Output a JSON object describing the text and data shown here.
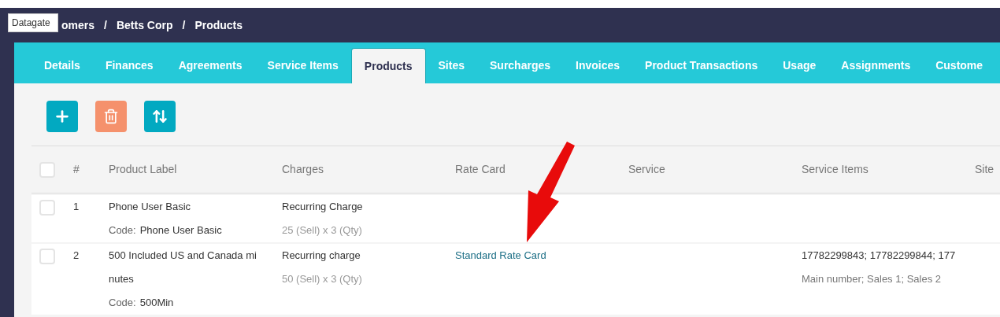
{
  "tooltip": {
    "text": "Datagate"
  },
  "breadcrumb": {
    "items": [
      "omers",
      "Betts Corp",
      "Products"
    ],
    "separator": "/"
  },
  "tabs": [
    {
      "label": "Details",
      "selected": false
    },
    {
      "label": "Finances",
      "selected": false
    },
    {
      "label": "Agreements",
      "selected": false
    },
    {
      "label": "Service Items",
      "selected": false
    },
    {
      "label": "Products",
      "selected": true
    },
    {
      "label": "Sites",
      "selected": false
    },
    {
      "label": "Surcharges",
      "selected": false
    },
    {
      "label": "Invoices",
      "selected": false
    },
    {
      "label": "Product Transactions",
      "selected": false
    },
    {
      "label": "Usage",
      "selected": false
    },
    {
      "label": "Assignments",
      "selected": false
    },
    {
      "label": "Custome",
      "selected": false
    }
  ],
  "toolbar": [
    {
      "kind": "add"
    },
    {
      "kind": "delete"
    },
    {
      "kind": "sort"
    }
  ],
  "table": {
    "select_all_checked": false,
    "columns": [
      "#",
      "Product Label",
      "Charges",
      "Rate Card",
      "Service",
      "Service Items",
      "Site"
    ],
    "rows": [
      {
        "checked": false,
        "number": "1",
        "label": "Phone User Basic",
        "code_label": "Code:",
        "code": "Phone User Basic",
        "charge": "Recurring Charge",
        "charge_detail": "25 (Sell) x 3 (Qty)"
      },
      {
        "checked": false,
        "number": "2",
        "label": "500 Included US and Canada mi nutes",
        "code_label": "Code:",
        "code": "500Min",
        "charge": "Recurring charge",
        "charge_detail": "50 (Sell) x 3 (Qty)",
        "rate_card": "Standard Rate Card",
        "service_items": "17782299843; 17782299844; 177",
        "service_items_detail": "Main number; Sales 1; Sales 2"
      }
    ]
  }
}
